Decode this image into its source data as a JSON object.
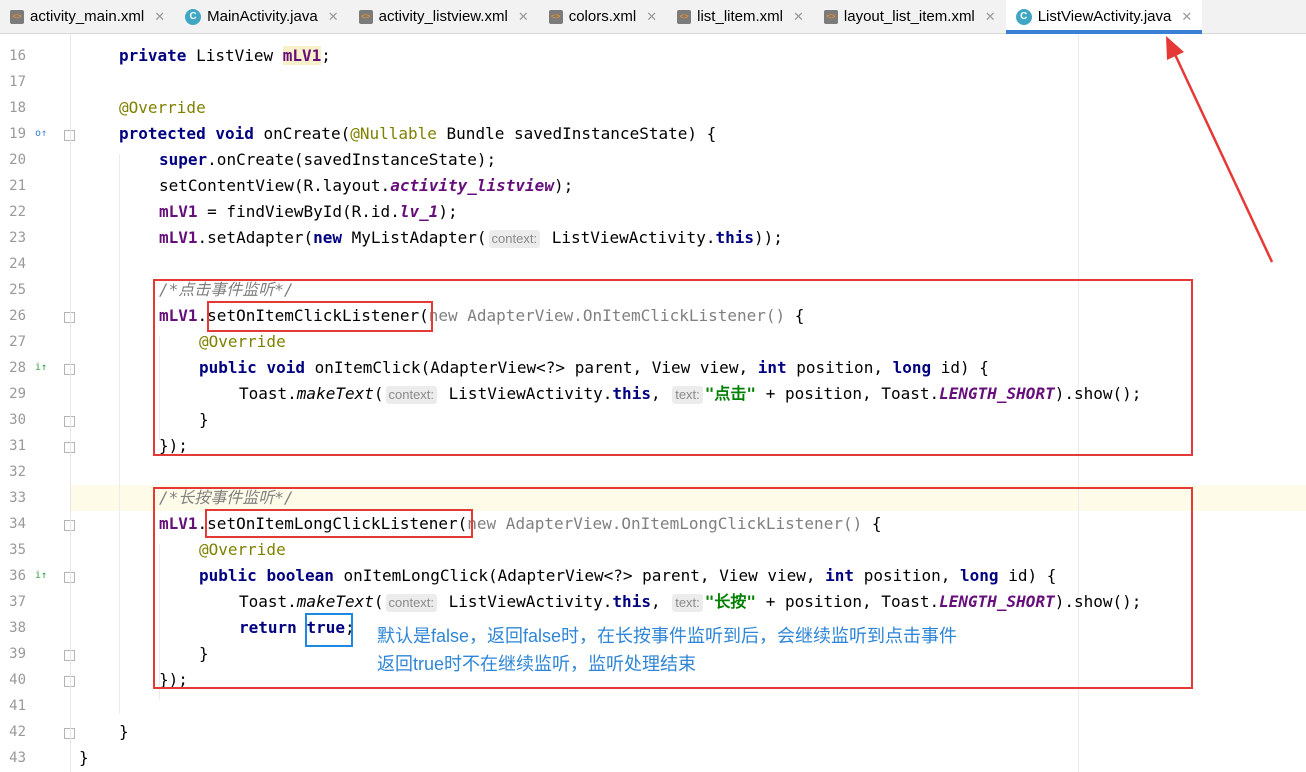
{
  "tabs": [
    {
      "label": "activity_main.xml",
      "type": "xml"
    },
    {
      "label": "MainActivity.java",
      "type": "java"
    },
    {
      "label": "activity_listview.xml",
      "type": "xml"
    },
    {
      "label": "colors.xml",
      "type": "xml"
    },
    {
      "label": "list_litem.xml",
      "type": "xml"
    },
    {
      "label": "layout_list_item.xml",
      "type": "xml"
    },
    {
      "label": "ListViewActivity.java",
      "type": "java",
      "active": true
    }
  ],
  "line_numbers": [
    "16",
    "17",
    "18",
    "19",
    "20",
    "21",
    "22",
    "23",
    "24",
    "25",
    "26",
    "27",
    "28",
    "29",
    "30",
    "31",
    "32",
    "33",
    "34",
    "35",
    "36",
    "37",
    "38",
    "39",
    "40",
    "41",
    "42",
    "43"
  ],
  "code": {
    "l16": {
      "kw": "private",
      "t1": " ListView ",
      "var": "mLV1",
      "t2": ";"
    },
    "l18": {
      "ann": "@Override"
    },
    "l19": {
      "kw1": "protected",
      "kw2": "void",
      "t1": " onCreate(",
      "ann": "@Nullable",
      "t2": " Bundle savedInstanceState) {"
    },
    "l20": {
      "kw": "super",
      "t1": ".onCreate(savedInstanceState);"
    },
    "l21": {
      "t1": "setContentView(R.layout.",
      "fld": "activity_listview",
      "t2": ");"
    },
    "l22": {
      "fld1": "mLV1",
      "t1": " = findViewById(R.id.",
      "fld2": "lv_1",
      "t2": ");"
    },
    "l23": {
      "fld": "mLV1",
      "t1": ".setAdapter(",
      "kw": "new",
      "t2": " MyListAdapter(",
      "hint": "context:",
      "t3": " ListViewActivity.",
      "kw2": "this",
      "t4": "));"
    },
    "l25": {
      "cm": "/*点击事件监听*/"
    },
    "l26": {
      "fld": "mLV1",
      "t1": ".",
      "method": "setOnItemClickListener",
      "t2": "(",
      "kw": "new",
      "gray": " AdapterView.OnItemClickListener() ",
      "t3": "{"
    },
    "l27": {
      "ann": "@Override"
    },
    "l28": {
      "kw1": "public",
      "kw2": "void",
      "t1": " onItemClick(AdapterView<?> parent, View view, ",
      "kw3": "int",
      "t2": " position, ",
      "kw4": "long",
      "t3": " id) {"
    },
    "l29": {
      "t1": "Toast.",
      "ital": "makeText",
      "t2": "(",
      "hint1": "context:",
      "t3": " ListViewActivity.",
      "kw": "this",
      "t4": ", ",
      "hint2": "text:",
      "str": "\"点击\"",
      "t5": " + position, Toast.",
      "fldi": "LENGTH_SHORT",
      "t6": ").show();"
    },
    "l30": {
      "t1": "}"
    },
    "l31": {
      "t1": "});"
    },
    "l33": {
      "cm": "/*长按事件监听*/"
    },
    "l34": {
      "fld": "mLV1",
      "t1": ".",
      "method": "setOnItemLongClickListener",
      "t2": "(",
      "kw": "new",
      "gray": " AdapterView.OnItemLongClickListener() ",
      "t3": "{"
    },
    "l35": {
      "ann": "@Override"
    },
    "l36": {
      "kw1": "public",
      "kw2": "boolean",
      "t1": " onItemLongClick(AdapterView<?> parent, View view, ",
      "kw3": "int",
      "t2": " position, ",
      "kw4": "long",
      "t3": " id) {"
    },
    "l37": {
      "t1": "Toast.",
      "ital": "makeText",
      "t2": "(",
      "hint1": "context:",
      "t3": " ListViewActivity.",
      "kw": "this",
      "t4": ", ",
      "hint2": "text:",
      "str": "\"长按\"",
      "t5": " + position, Toast.",
      "fldi": "LENGTH_SHORT",
      "t6": ").show();"
    },
    "l38": {
      "kw": "return",
      "t1": " ",
      "kwt": "true",
      "t2": ";"
    },
    "l39": {
      "t1": "}"
    },
    "l40": {
      "t1": "});"
    },
    "l42": {
      "t1": "}"
    },
    "l43": {
      "t1": "}"
    }
  },
  "annotation": {
    "line1": "默认是false，返回false时，在长按事件监听到后，会继续监听到点击事件",
    "line2": "返回true时不在继续监听，监听处理结束"
  },
  "colors": {
    "box_red": "#e53935",
    "box_blue": "#1e88e5",
    "note_blue": "#2f86d6",
    "tab_accent": "#3a7fd6"
  }
}
